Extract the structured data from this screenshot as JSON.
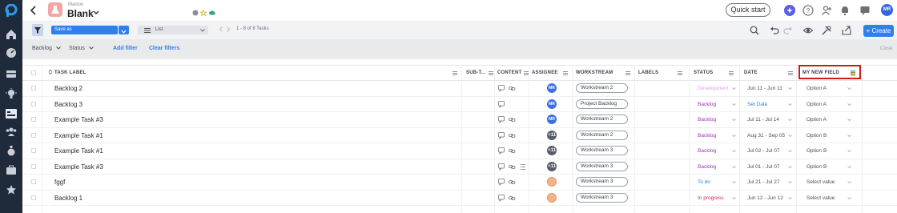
{
  "project": {
    "small_label": "Maison",
    "title": "Blank"
  },
  "header": {
    "quick_start": "Quick start",
    "avatar_initials": "MR"
  },
  "toolbar": {
    "save_as": "Save as",
    "view": "List",
    "pager_text": "1 - 8 of 8 Tasks",
    "create": "+ Create"
  },
  "filters": {
    "backlog": "Backlog",
    "status": "Status",
    "add_filter": "Add filter",
    "clear_filters": "Clear filters",
    "close": "Close"
  },
  "columns": {
    "task_label": "TASK LABEL",
    "sub_t": "SUB-T...",
    "content": "CONTENT",
    "assignee": "ASSIGNEE",
    "workstream": "WORKSTREAM",
    "labels": "LABELS",
    "status": "STATUS",
    "date": "DATE",
    "my_new_field": "MY NEW FIELD"
  },
  "colors": {
    "accent": "#2f80ed",
    "status_development": "#d9a7e8",
    "status_backlog": "#9b32b8",
    "status_todo": "#2f80ed",
    "status_inprogress": "#d0246b",
    "highlight_border": "#d0191c"
  },
  "rows": [
    {
      "label": "Backlog 2",
      "assignee": "MR",
      "assignee_type": "initials",
      "workstream": "Workstream 2",
      "status": "Development",
      "status_kind": "development",
      "date": "Jun 11 - Jun 11",
      "date_is_link": false,
      "field": "Option A",
      "extra_icon": false
    },
    {
      "label": "Backlog 3",
      "assignee": "MR",
      "assignee_type": "initials",
      "workstream": "Project Backlog",
      "status": "Backlog",
      "status_kind": "backlog",
      "date": "Set Date",
      "date_is_link": true,
      "field": "Option A",
      "extra_icon": false
    },
    {
      "label": "Example Task #3",
      "assignee": "MR",
      "assignee_type": "initials",
      "workstream": "Workstream 2",
      "status": "Backlog",
      "status_kind": "backlog",
      "date": "Jul 11 - Jul 14",
      "date_is_link": false,
      "field": "Option A",
      "extra_icon": false
    },
    {
      "label": "Example Task #1",
      "assignee": "+11",
      "assignee_type": "count",
      "workstream": "Workstream 2",
      "status": "Backlog",
      "status_kind": "backlog",
      "date": "Aug 31 - Sep 05",
      "date_is_link": false,
      "field": "Option B",
      "extra_icon": false
    },
    {
      "label": "Example Task #1",
      "assignee": "+11",
      "assignee_type": "count",
      "workstream": "Workstream 3",
      "status": "Backlog",
      "status_kind": "backlog",
      "date": "Jul 02 - Jul 07",
      "date_is_link": false,
      "field": "Option B",
      "extra_icon": false
    },
    {
      "label": "Example Task #3",
      "assignee": "+11",
      "assignee_type": "count",
      "workstream": "Workstream 3",
      "status": "Backlog",
      "status_kind": "backlog",
      "date": "Jul 01 - Jul 07",
      "date_is_link": false,
      "field": "Option B",
      "extra_icon": true
    },
    {
      "label": "fggf",
      "assignee": "",
      "assignee_type": "face",
      "workstream": "Workstream 3",
      "status": "To do",
      "status_kind": "todo",
      "date": "Jul 21 - Jul 27",
      "date_is_link": false,
      "field": "Select value",
      "extra_icon": false
    },
    {
      "label": "Backlog 1",
      "assignee": "",
      "assignee_type": "face",
      "workstream": "Workstream 3",
      "status": "In progress",
      "status_kind": "inprogress",
      "date": "Jun 12 - Jun 12",
      "date_is_link": false,
      "field": "Select value",
      "extra_icon": false
    }
  ]
}
